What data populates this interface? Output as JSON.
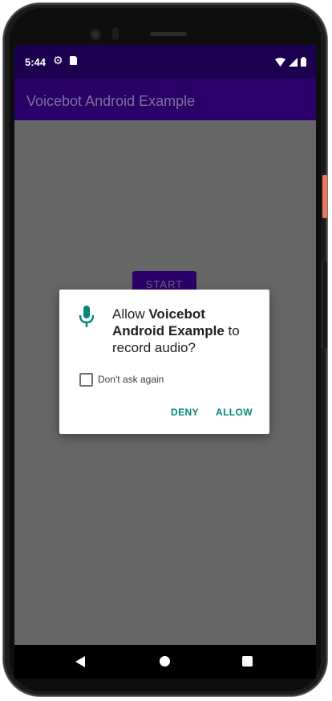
{
  "status_bar": {
    "time": "5:44",
    "icons": [
      "gear-icon",
      "sim-card-icon",
      "wifi-icon",
      "signal-icon",
      "battery-icon"
    ]
  },
  "app_bar": {
    "title": "Voicebot Android Example"
  },
  "main": {
    "start_label": "START"
  },
  "permission_dialog": {
    "icon": "microphone-icon",
    "message_prefix": "Allow ",
    "app_name": "Voicebot Android Example",
    "message_suffix": " to record audio?",
    "checkbox_label": "Don't ask again",
    "checkbox_checked": false,
    "deny_label": "DENY",
    "allow_label": "ALLOW",
    "accent_color": "#00897b"
  },
  "nav_bar": {
    "buttons": [
      "back-icon",
      "home-icon",
      "recents-icon"
    ]
  },
  "colors": {
    "status_bar": "#1b0050",
    "app_bar": "#2b0069",
    "scrim_background": "#666666"
  }
}
